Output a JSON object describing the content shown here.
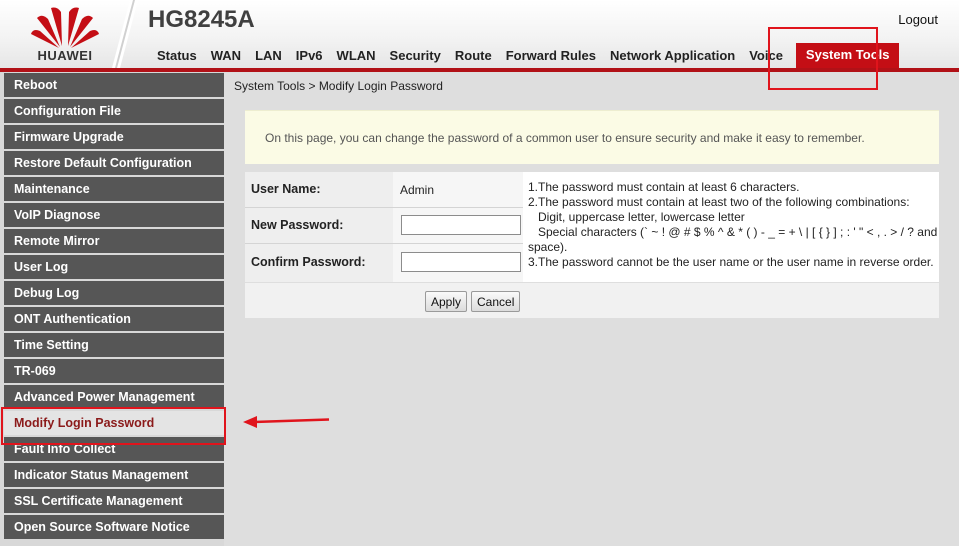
{
  "header": {
    "brand": "HUAWEI",
    "model": "HG8245A",
    "logout_label": "Logout",
    "brand_color": "#c40e15",
    "nav": [
      {
        "label": "Status",
        "active": false
      },
      {
        "label": "WAN",
        "active": false
      },
      {
        "label": "LAN",
        "active": false
      },
      {
        "label": "IPv6",
        "active": false
      },
      {
        "label": "WLAN",
        "active": false
      },
      {
        "label": "Security",
        "active": false
      },
      {
        "label": "Route",
        "active": false
      },
      {
        "label": "Forward Rules",
        "active": false
      },
      {
        "label": "Network Application",
        "active": false
      },
      {
        "label": "Voice",
        "active": false
      },
      {
        "label": "System Tools",
        "active": true
      }
    ]
  },
  "sidebar": {
    "items": [
      {
        "label": "Reboot",
        "active": false
      },
      {
        "label": "Configuration File",
        "active": false
      },
      {
        "label": "Firmware Upgrade",
        "active": false
      },
      {
        "label": "Restore Default Configuration",
        "active": false
      },
      {
        "label": "Maintenance",
        "active": false
      },
      {
        "label": "VoIP Diagnose",
        "active": false
      },
      {
        "label": "Remote Mirror",
        "active": false
      },
      {
        "label": "User Log",
        "active": false
      },
      {
        "label": "Debug Log",
        "active": false
      },
      {
        "label": "ONT Authentication",
        "active": false
      },
      {
        "label": "Time Setting",
        "active": false
      },
      {
        "label": "TR-069",
        "active": false
      },
      {
        "label": "Advanced Power Management",
        "active": false
      },
      {
        "label": "Modify Login Password",
        "active": true
      },
      {
        "label": "Fault Info Collect",
        "active": false
      },
      {
        "label": "Indicator Status Management",
        "active": false
      },
      {
        "label": "SSL Certificate Management",
        "active": false
      },
      {
        "label": "Open Source Software Notice",
        "active": false
      }
    ]
  },
  "main": {
    "breadcrumb": "System Tools > Modify Login Password",
    "info_text": "On this page, you can change the password of a common user to ensure security and make it easy to remember.",
    "form": {
      "user_name_label": "User Name:",
      "user_name_value": "Admin",
      "new_password_label": "New Password:",
      "new_password_value": "",
      "confirm_password_label": "Confirm Password:",
      "confirm_password_value": ""
    },
    "rules": [
      {
        "text": "1.The password must contain at least 6 characters.",
        "indent": false
      },
      {
        "text": "2.The password must contain at least two of the following combinations:",
        "indent": false
      },
      {
        "text": "Digit, uppercase letter, lowercase letter",
        "indent": true
      },
      {
        "text": "Special characters (` ~ ! @ # $ % ^ & * ( ) - _ = + \\ | [ { } ] ; : ' \" < , . > / ? and",
        "indent": true
      },
      {
        "text": "space).",
        "indent": false
      },
      {
        "text": "3.The password cannot be the user name or the user name in reverse order.",
        "indent": false
      }
    ],
    "apply_label": "Apply",
    "cancel_label": "Cancel"
  },
  "annotations": {
    "highlight_color": "#e0141c"
  }
}
